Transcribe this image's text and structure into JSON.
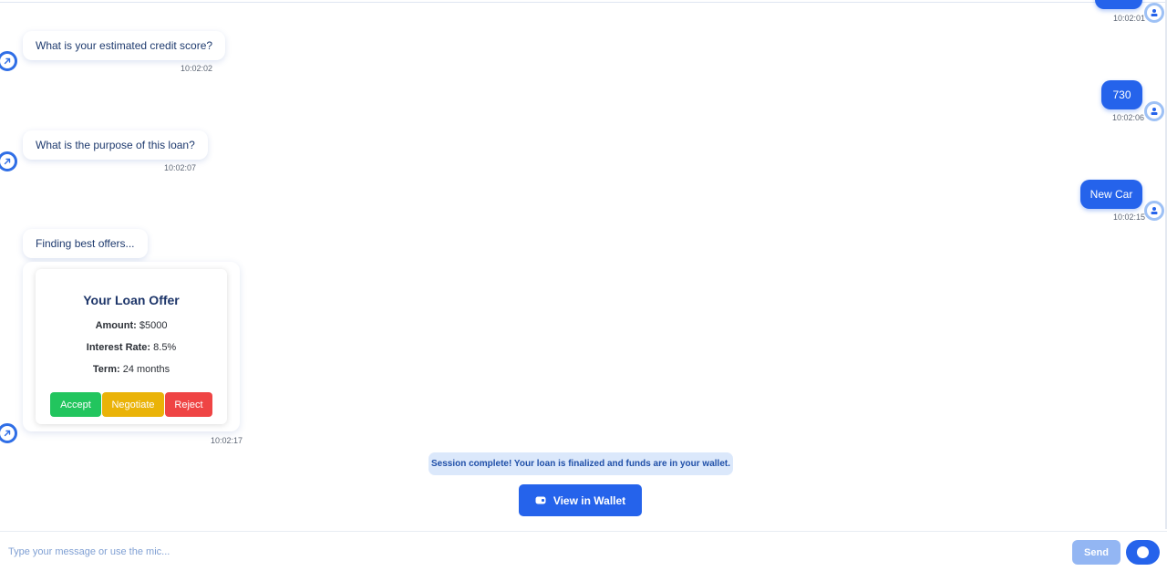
{
  "messages": [
    {
      "role": "user",
      "text": "",
      "time": "10:02:01"
    },
    {
      "role": "bot",
      "text": "What is your estimated credit score?",
      "time": "10:02:02"
    },
    {
      "role": "user",
      "text": "730",
      "time": "10:02:06"
    },
    {
      "role": "bot",
      "text": "What is the purpose of this loan?",
      "time": "10:02:07"
    },
    {
      "role": "user",
      "text": "New Car",
      "time": "10:02:15"
    },
    {
      "role": "bot",
      "text": "Finding best offers...",
      "time": ""
    }
  ],
  "offer": {
    "title": "Your Loan Offer",
    "amount_label": "Amount:",
    "amount_value": "$5000",
    "rate_label": "Interest Rate:",
    "rate_value": "8.5%",
    "term_label": "Term:",
    "term_value": "24 months",
    "accept_label": "Accept",
    "negotiate_label": "Negotiate",
    "reject_label": "Reject",
    "time": "10:02:17"
  },
  "session_notice": "Session complete! Your loan is finalized and funds are in your wallet.",
  "wallet_button_label": "View in Wallet",
  "composer": {
    "placeholder": "Type your message or use the mic...",
    "value": "",
    "send_label": "Send"
  },
  "icons": {
    "bot_avatar": "arrow-up-right-icon",
    "user_avatar": "user-icon",
    "wallet": "wallet-icon",
    "mic": "mic-icon"
  },
  "colors": {
    "primary": "#2563eb",
    "accept": "#22c55e",
    "negotiate": "#eab308",
    "reject": "#ef4444",
    "send_disabled": "#93b6f3",
    "notice_bg": "#dbe8fb"
  }
}
